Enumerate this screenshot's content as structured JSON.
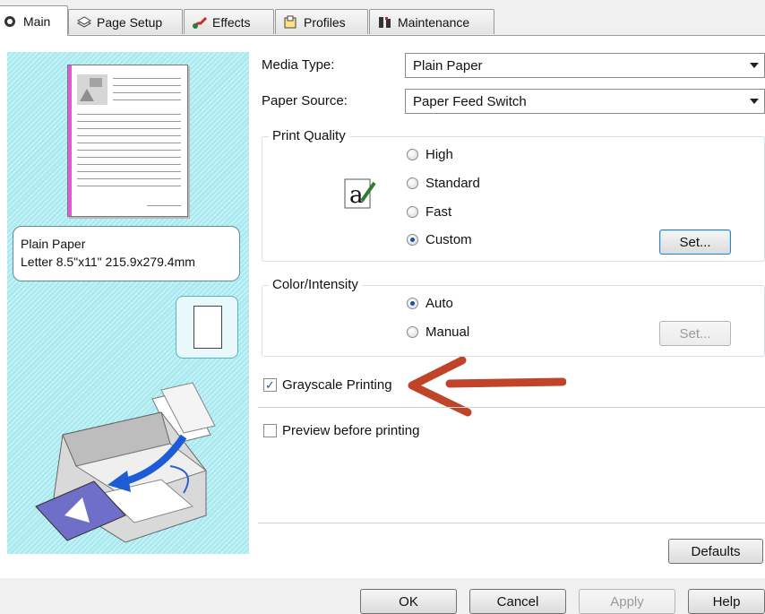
{
  "tabs": [
    {
      "label": "Main",
      "icon": "printer-icon",
      "active": true
    },
    {
      "label": "Page Setup",
      "icon": "page-stack-icon"
    },
    {
      "label": "Effects",
      "icon": "brush-icon"
    },
    {
      "label": "Profiles",
      "icon": "profiles-icon"
    },
    {
      "label": "Maintenance",
      "icon": "tools-icon"
    }
  ],
  "preview": {
    "media_name": "Plain Paper",
    "paper_size": "Letter 8.5\"x11\" 215.9x279.4mm"
  },
  "form": {
    "media_type_label": "Media Type:",
    "media_type_value": "Plain Paper",
    "paper_source_label": "Paper Source:",
    "paper_source_value": "Paper Feed Switch",
    "print_quality": {
      "title": "Print Quality",
      "options": [
        "High",
        "Standard",
        "Fast",
        "Custom"
      ],
      "selected": "Custom",
      "set_label": "Set..."
    },
    "color_intensity": {
      "title": "Color/Intensity",
      "options": [
        "Auto",
        "Manual"
      ],
      "selected": "Auto",
      "set_label": "Set..."
    },
    "grayscale_label": "Grayscale Printing",
    "grayscale_checked": true,
    "preview_label": "Preview before printing",
    "preview_checked": false,
    "defaults_label": "Defaults"
  },
  "footer": {
    "ok": "OK",
    "cancel": "Cancel",
    "apply": "Apply",
    "help": "Help"
  },
  "colors": {
    "preview_bg": "#a9eaf1",
    "annotation_arrow": "#c0442a",
    "radio_selected": "#1d4fa8"
  }
}
